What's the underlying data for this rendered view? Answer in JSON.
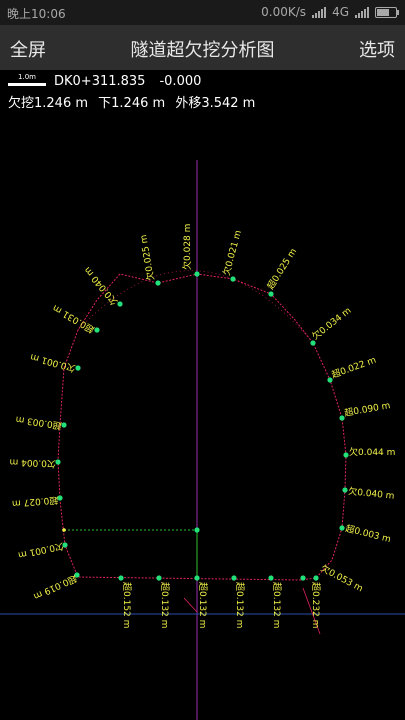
{
  "status_bar": {
    "time": "晚上10:06",
    "speed": "0.00K/s",
    "network": "4G"
  },
  "app_bar": {
    "left_button": "全屏",
    "title": "隧道超欠挖分析图",
    "right_button": "选项"
  },
  "info": {
    "scale_label": "1.0m",
    "station": "DK0+311.835",
    "offset_value": "-0.000",
    "underbreak": "欠挖1.246 m",
    "lower": "下1.246 m",
    "outward": "外移3.542 m"
  },
  "colors": {
    "profile_line": "#e0245e",
    "point": "#22e07a",
    "label": "#f2f24a",
    "axis_vertical": "#9b2fb0",
    "axis_horizontal": "#2a4fa8",
    "baseline": "#2fbf2f"
  },
  "measurements": [
    {
      "name": "label-top-center",
      "text": "欠0.028 m"
    },
    {
      "name": "label-top-right-1",
      "text": "欠0.021 m"
    },
    {
      "name": "label-top-right-2",
      "text": "超0.025 m"
    },
    {
      "name": "label-right-1",
      "text": "欠0.034 m"
    },
    {
      "name": "label-right-2",
      "text": "超0.022 m"
    },
    {
      "name": "label-right-3",
      "text": "超0.090 m"
    },
    {
      "name": "label-right-4",
      "text": "欠0.044 m"
    },
    {
      "name": "label-right-5",
      "text": "欠0.040 m"
    },
    {
      "name": "label-right-6",
      "text": "超0.003 m"
    },
    {
      "name": "label-right-7",
      "text": "欠0.053 m"
    },
    {
      "name": "label-top-left-1",
      "text": "欠0.025 m"
    },
    {
      "name": "label-top-left-2",
      "text": "欠0.040 m"
    },
    {
      "name": "label-left-1",
      "text": "超0.031 m"
    },
    {
      "name": "label-left-2",
      "text": "欠0.001 m"
    },
    {
      "name": "label-left-3",
      "text": "超0.003 m"
    },
    {
      "name": "label-left-4",
      "text": "欠0.004 m"
    },
    {
      "name": "label-left-5",
      "text": "超0.027 m"
    },
    {
      "name": "label-left-6",
      "text": "欠0.001 m"
    },
    {
      "name": "label-left-7",
      "text": "超0.019 m"
    },
    {
      "name": "label-bottom-1",
      "text": "超0.152 m"
    },
    {
      "name": "label-bottom-2",
      "text": "超0.132 m"
    },
    {
      "name": "label-bottom-3",
      "text": "超0.132 m"
    },
    {
      "name": "label-bottom-4",
      "text": "超0.132 m"
    },
    {
      "name": "label-bottom-5",
      "text": "超0.132 m"
    },
    {
      "name": "label-bottom-6",
      "text": "超0.232 m"
    }
  ]
}
